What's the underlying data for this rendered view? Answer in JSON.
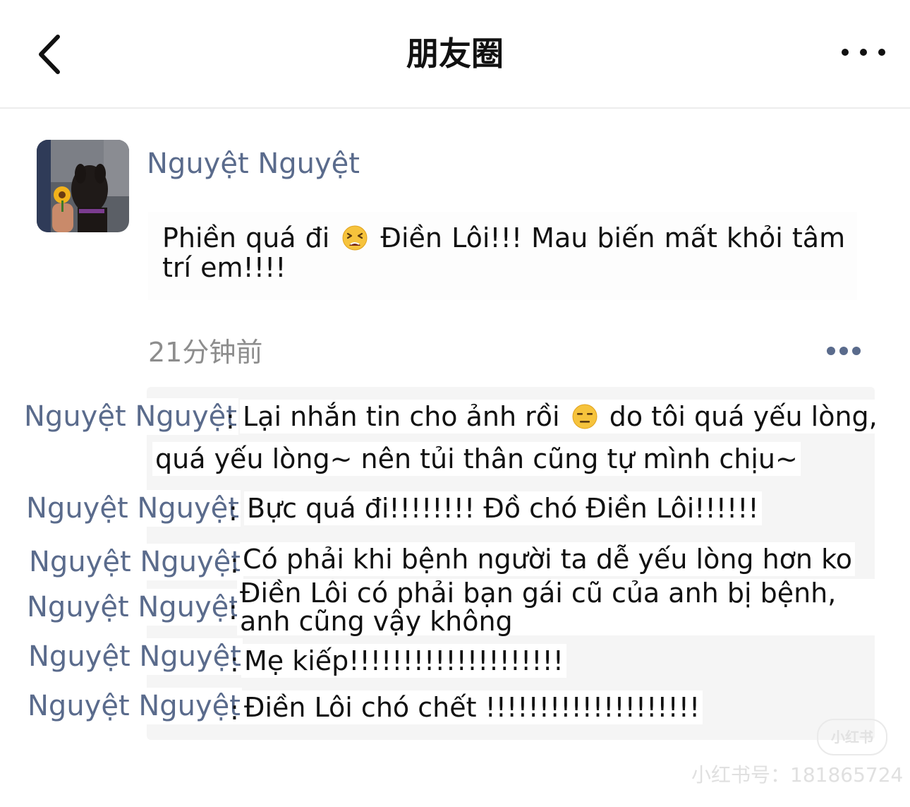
{
  "nav": {
    "title": "朋友圈",
    "back_icon": "chevron-left-icon",
    "more_icon": "more-horizontal-icon"
  },
  "post": {
    "author": "Nguyệt Nguyệt",
    "text_part1": "Phiền quá đi",
    "emoji1": "tired-face-emoji",
    "text_part2": "Điền Lôi!!! Mau biến mất khỏi tâm trí em!!!!",
    "time": "21分钟前",
    "action_icon": "more-dots-icon"
  },
  "comments": [
    {
      "name": "Nguyệt Nguyệt",
      "colon": ":",
      "text_a": "Lại nhắn tin cho ảnh rồi",
      "emoji": "expressionless-face-emoji",
      "text_b": "do tôi quá yếu lòng,",
      "text_c": "quá yếu lòng~ nên tủi thân cũng tự mình chịu~"
    },
    {
      "name": "Nguyệt Nguyệt",
      "colon": ":",
      "text": "Bực quá đi!!!!!!!! Đồ chó Điền Lôi!!!!!!"
    },
    {
      "name": "Nguyệt Nguyệt",
      "colon": ":",
      "text": "Có phải khi bệnh người ta dễ yếu lòng hơn ko"
    },
    {
      "name": "Nguyệt Nguyệt",
      "colon": ":",
      "text": "Điền Lôi có phải bạn gái cũ của anh bị bệnh, anh cũng vậy không"
    },
    {
      "name": "Nguyệt Nguyệt",
      "colon": ":",
      "text": "Mẹ kiếp!!!!!!!!!!!!!!!!!!!!"
    },
    {
      "name": "Nguyệt Nguyệt",
      "colon": ":",
      "text": "Điền Lôi chó chết !!!!!!!!!!!!!!!!!!!!"
    }
  ],
  "watermark": {
    "logo": "小红书",
    "id": "小红书号：181865724"
  },
  "colors": {
    "name_blue": "#5a6b8c",
    "panel_gray": "#f5f5f5",
    "time_gray": "#8d8d8d"
  }
}
